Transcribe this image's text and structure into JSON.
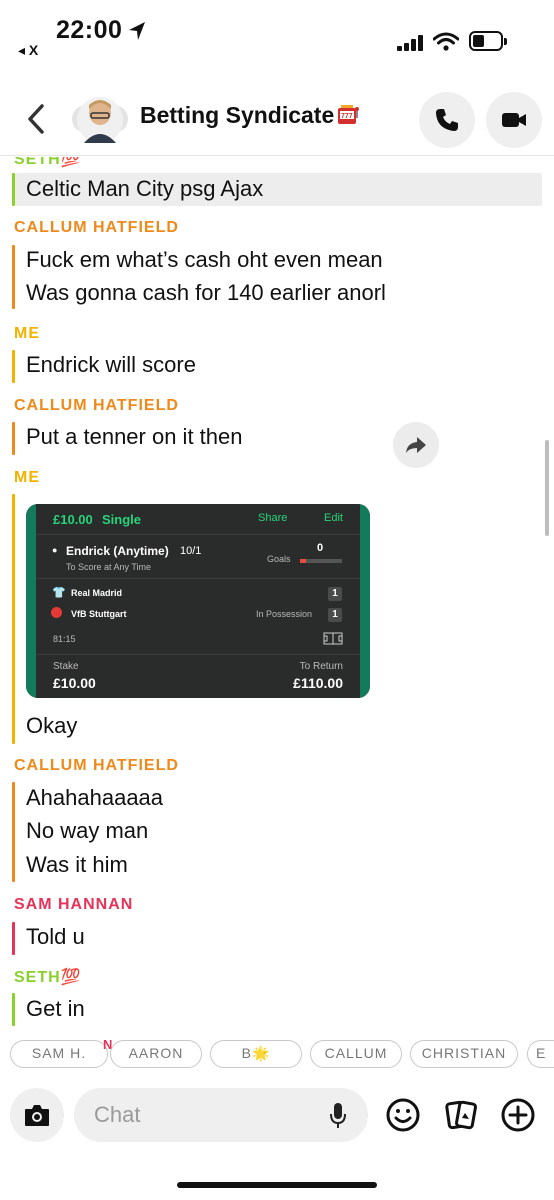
{
  "status_bar": {
    "time": "22:00",
    "back_app": "◂ X"
  },
  "header": {
    "title": "Betting Syndicate"
  },
  "messages": [
    {
      "sender": "SETH💯",
      "lines": [
        "Celtic Man City psg Ajax"
      ]
    },
    {
      "sender": "CALLUM HATFIELD",
      "lines": [
        "Fuck em what’s cash oht even mean",
        "Was gonna cash for 140 earlier anorl"
      ]
    },
    {
      "sender": "ME",
      "lines": [
        "Endrick will score"
      ]
    },
    {
      "sender": "CALLUM HATFIELD",
      "lines": [
        "Put a tenner on it then"
      ]
    },
    {
      "sender": "ME",
      "lines": [
        "Okay"
      ]
    },
    {
      "sender": "CALLUM HATFIELD",
      "lines": [
        "Ahahahaaaaa",
        "No way man",
        "Was it him"
      ]
    },
    {
      "sender": "SAM HANNAN",
      "lines": [
        "Told u"
      ]
    },
    {
      "sender": "SETH💯",
      "lines": [
        "Get in"
      ]
    }
  ],
  "bet_slip": {
    "stake_header": "£10.00",
    "bet_type": "Single",
    "share": "Share",
    "edit": "Edit",
    "selection": "Endrick (Anytime)",
    "odds": "10/1",
    "market": "To Score at Any Time",
    "goals_label": "Goals",
    "goals_value": "0",
    "home_team": "Real Madrid",
    "home_score": "1",
    "away_team": "VfB Stuttgart",
    "possession_label": "In Possession",
    "away_score": "1",
    "match_time": "81:15",
    "stake_label": "Stake",
    "stake_value": "£10.00",
    "return_label": "To Return",
    "return_value": "£110.00"
  },
  "chips": [
    "SAM H.",
    "AARON",
    "B🌟",
    "CALLUM",
    "CHRISTIAN",
    "E"
  ],
  "chip_overlap": "N",
  "input": {
    "placeholder": "Chat"
  },
  "colors": {
    "seth": "#8ad12b",
    "callum": "#ee8a1b",
    "me": "#f0b400",
    "sam": "#e7335a",
    "slip_green": "#137a5b"
  }
}
